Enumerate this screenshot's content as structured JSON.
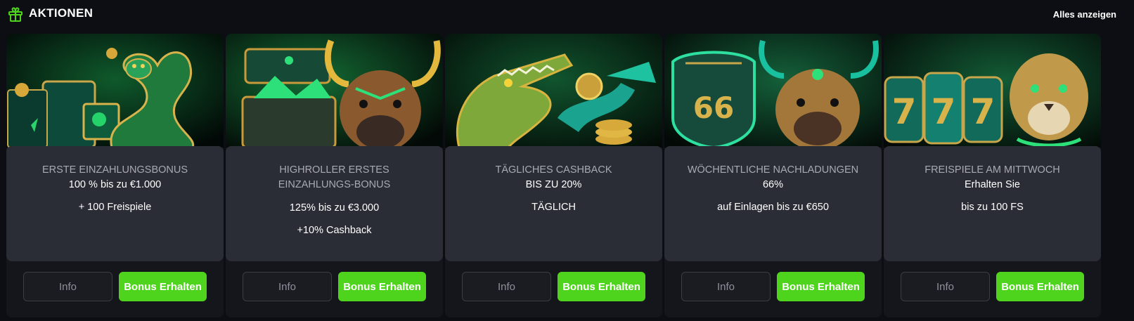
{
  "header": {
    "icon": "gift-icon",
    "title": "AKTIONEN",
    "see_all": "Alles anzeigen"
  },
  "colors": {
    "accent_green": "#4fd41d",
    "background": "#0d0e13",
    "panel": "#2b2d36"
  },
  "promotions": [
    {
      "art": "snake-and-gift-box-illustration",
      "lines": [
        {
          "text": "ERSTE EINZAHLUNGSBONUS",
          "style": "muted"
        },
        {
          "text": "100 % bis zu €1.000",
          "style": "bright"
        },
        {
          "text": "+ 100 Freispiele",
          "style": "bright"
        }
      ],
      "info_label": "Info",
      "bonus_label": "Bonus Erhalten"
    },
    {
      "art": "bull-and-treasure-chest-illustration",
      "lines": [
        {
          "text": "HIGHROLLER ERSTES",
          "style": "muted"
        },
        {
          "text": "EINZAHLUNGS-BONUS",
          "style": "muted"
        },
        {
          "text": "125% bis zu €3.000",
          "style": "bright"
        },
        {
          "text": "+10% Cashback",
          "style": "bright"
        }
      ],
      "info_label": "Info",
      "bonus_label": "Bonus Erhalten"
    },
    {
      "art": "crocodile-and-gold-coins-illustration",
      "lines": [
        {
          "text": "TÄGLICHES CASHBACK",
          "style": "muted"
        },
        {
          "text": "BIS ZU 20%",
          "style": "bright"
        },
        {
          "text": "TÄGLICH",
          "style": "bright"
        }
      ],
      "info_label": "Info",
      "bonus_label": "Bonus Erhalten"
    },
    {
      "art": "bison-and-route-66-sign-illustration",
      "lines": [
        {
          "text": "WÖCHENTLICHE NACHLADUNGEN",
          "style": "muted"
        },
        {
          "text": "66%",
          "style": "bright"
        },
        {
          "text": "auf Einlagen bis zu €650",
          "style": "bright"
        }
      ],
      "info_label": "Info",
      "bonus_label": "Bonus Erhalten"
    },
    {
      "art": "jaguar-and-777-slot-illustration",
      "lines": [
        {
          "text": "FREISPIELE AM MITTWOCH",
          "style": "muted"
        },
        {
          "text": "Erhalten Sie",
          "style": "bright"
        },
        {
          "text": "bis zu 100 FS",
          "style": "bright"
        }
      ],
      "info_label": "Info",
      "bonus_label": "Bonus Erhalten"
    }
  ]
}
